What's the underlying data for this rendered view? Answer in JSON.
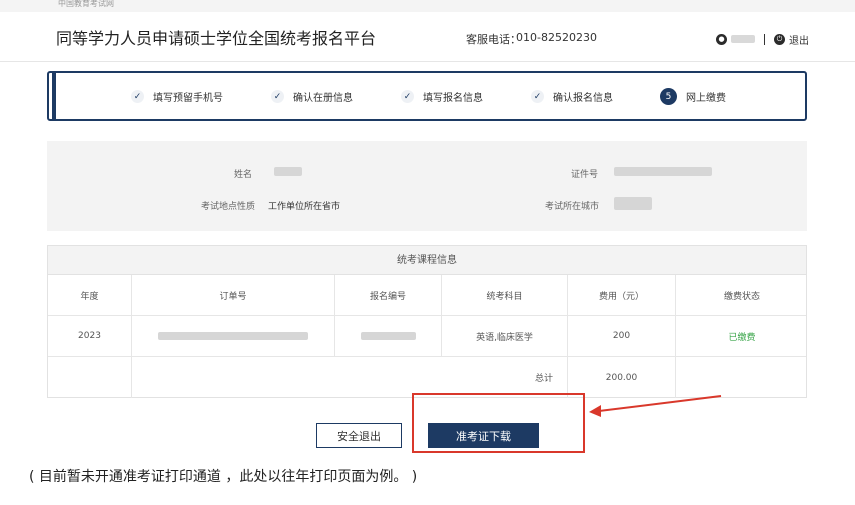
{
  "topbar": {
    "org": "中国教育考试网"
  },
  "header": {
    "title": "同等学力人员申请硕士学位全国统考报名平台",
    "hotline_label": "客服电话：",
    "hotline_value": "010-82520230",
    "logout_label": "退出"
  },
  "steps": [
    {
      "label": "填写预留手机号",
      "state": "done"
    },
    {
      "label": "确认在册信息",
      "state": "done"
    },
    {
      "label": "填写报名信息",
      "state": "done"
    },
    {
      "label": "确认报名信息",
      "state": "done"
    },
    {
      "label": "网上缴费",
      "state": "current",
      "number": "5"
    }
  ],
  "info": {
    "name_label": "姓名",
    "id_label": "证件号",
    "site_type_label": "考试地点性质",
    "site_type_value": "工作单位所在省市",
    "city_label": "考试所在城市"
  },
  "course": {
    "caption": "统考课程信息",
    "headers": [
      "年度",
      "订单号",
      "报名编号",
      "统考科目",
      "费用（元）",
      "缴费状态"
    ],
    "row": {
      "year": "2023",
      "subject": "英语,临床医学",
      "fee": "200",
      "status": "已缴费"
    },
    "total_label": "总计",
    "total_value": "200.00"
  },
  "buttons": {
    "exit": "安全退出",
    "download": "准考证下载"
  },
  "caption": "( 目前暂未开通准考证打印通道 ，此处以往年打印页面为例。 )",
  "colors": {
    "primary": "#1d3a63",
    "paid": "#3aa54a",
    "highlight": "#d9382b"
  }
}
